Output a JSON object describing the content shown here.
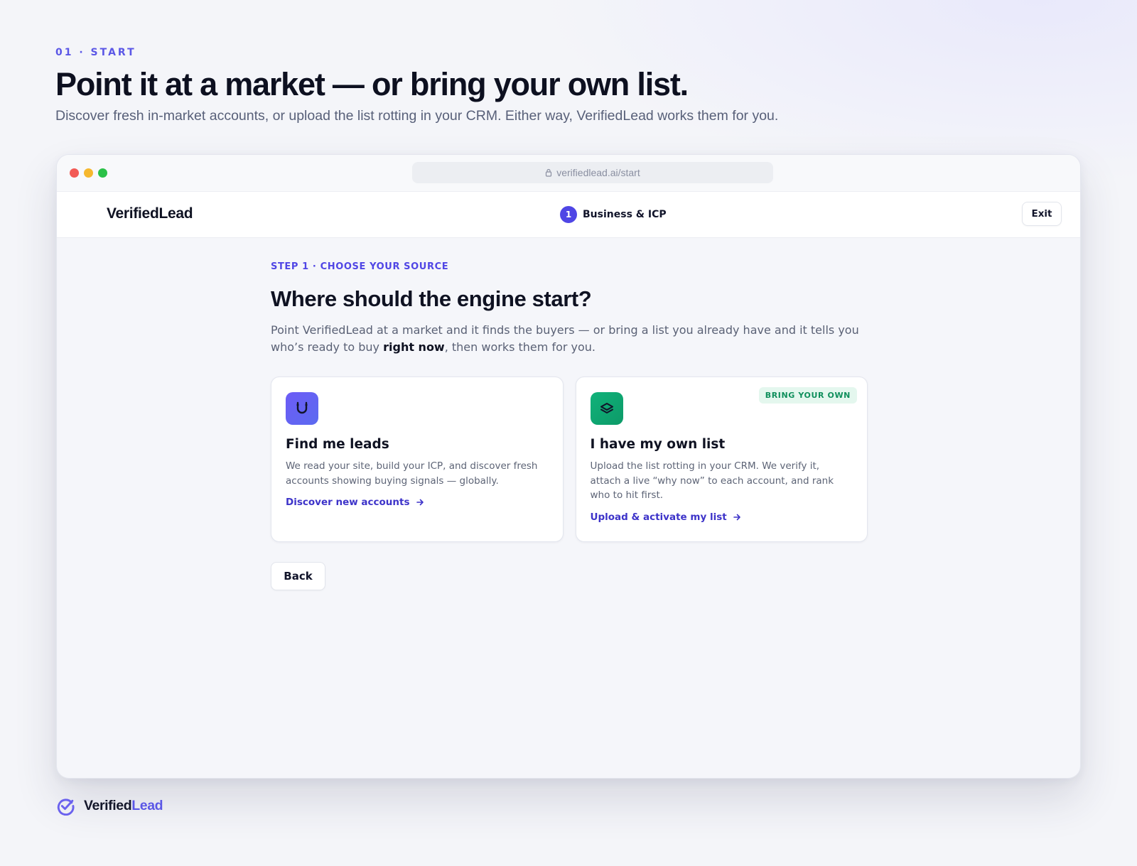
{
  "hero": {
    "eyebrow": "01 · START",
    "title": "Point it at a market — or bring your own list.",
    "subtitle": "Discover fresh in-market accounts, or upload the list rotting in your CRM. Either way, VerifiedLead works them for you."
  },
  "browser": {
    "url": "verifiedlead.ai/start"
  },
  "appbar": {
    "brand": "VerifiedLead",
    "step_number": "1",
    "step_label": "Business & ICP",
    "exit_label": "Exit"
  },
  "main": {
    "eyebrow": "STEP 1 · CHOOSE YOUR SOURCE",
    "title": "Where should the engine start?",
    "desc_before": "Point VerifiedLead at a market and it finds the buyers — or bring a list you already have and it tells you who’s ready to buy ",
    "desc_bold": "right now",
    "desc_after": ", then works them for you.",
    "back_label": "Back"
  },
  "cards": [
    {
      "icon": "magnet-icon",
      "title": "Find me leads",
      "desc": "We read your site, build your ICP, and discover fresh accounts showing buying signals — globally.",
      "link": "Discover new accounts",
      "accent": "#6d5cf6"
    },
    {
      "icon": "layers-icon",
      "badge": "BRING YOUR OWN",
      "title": "I have my own list",
      "desc": "Upload the list rotting in your CRM. We verify it, attach a live “why now” to each account, and rank who to hit first.",
      "link": "Upload & activate my list",
      "accent": "#10b27a"
    }
  ],
  "footer": {
    "brand_main": "Verified",
    "brand_accent": "Lead",
    "icon": "check-circle-icon"
  },
  "colors": {
    "accent": "#4f46e5",
    "link": "#3d33c9",
    "success": "#0f8f5c"
  }
}
